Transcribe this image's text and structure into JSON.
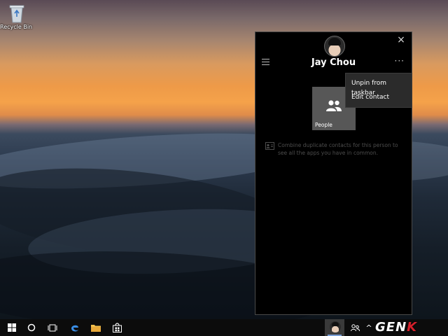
{
  "desktop": {
    "icons": [
      {
        "label": "Recycle Bin",
        "icon": "recycle-bin-icon"
      }
    ]
  },
  "people_panel": {
    "contact_name": "Jay Chou",
    "close_icon": "close-icon",
    "menu_icon": "hamburger-menu-icon",
    "more_label": "···",
    "tile": {
      "label": "People",
      "icon": "people-icon"
    },
    "combine_text": "Combine duplicate contacts for this person to see all the apps you have in common.",
    "context_menu": {
      "items": [
        "Unpin from taskbar",
        "Edit contact"
      ]
    }
  },
  "taskbar": {
    "buttons": [
      {
        "name": "start",
        "icon": "windows-logo-icon"
      },
      {
        "name": "search",
        "icon": "cortana-circle-icon"
      },
      {
        "name": "task-view",
        "icon": "task-view-icon"
      },
      {
        "name": "edge",
        "icon": "edge-icon"
      },
      {
        "name": "file-explorer",
        "icon": "folder-icon"
      },
      {
        "name": "store",
        "icon": "store-icon"
      }
    ],
    "tray": {
      "people_icon": "people-icon",
      "chevron": "^"
    },
    "watermark": {
      "text": "GEN",
      "accent": "K"
    }
  },
  "colors": {
    "panel_bg": "#000000",
    "tile_bg": "#575757",
    "menu_bg": "#2b2b2b",
    "taskbar_bg": "#0c0c0c"
  }
}
